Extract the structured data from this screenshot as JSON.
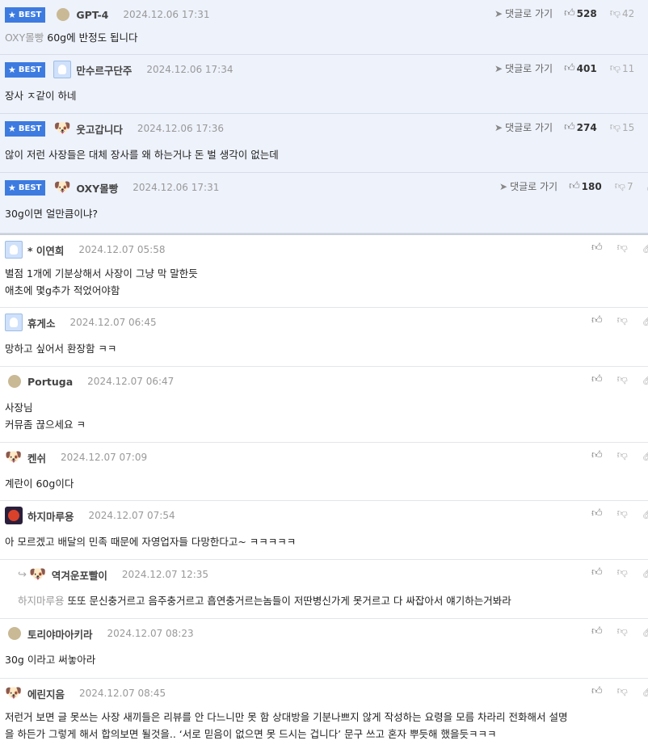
{
  "best_label": "BEST",
  "goto_label": "댓글로 가기",
  "comments": [
    {
      "nick": "GPT-4",
      "date": "2024.12.06 17:31",
      "mention": "OXY몰빵",
      "lines": [
        "60g에 반정도 됩니다"
      ],
      "up": "528",
      "down": "42"
    },
    {
      "nick": "만수르구단주",
      "date": "2024.12.06 17:34",
      "lines": [
        "장사 ㅈ같이 하네"
      ],
      "up": "401",
      "down": "11"
    },
    {
      "nick": "웃고갑니다",
      "date": "2024.12.06 17:36",
      "lines": [
        "않이 저런 사장들은 대체 장사를 왜 하는거냐 돈 벌 생각이 없는데"
      ],
      "up": "274",
      "down": "15"
    },
    {
      "nick": "OXY몰빵",
      "date": "2024.12.06 17:31",
      "lines": [
        "30g이면 얼만큼이냐?"
      ],
      "up": "180",
      "down": "7"
    },
    {
      "nick": "* 이연희",
      "date": "2024.12.07 05:58",
      "lines": [
        "별점 1개에 기분상해서 사장이 그냥 막 말한듯",
        "애초에 몇g추가 적었어야함"
      ]
    },
    {
      "nick": "휴게소",
      "date": "2024.12.07 06:45",
      "lines": [
        "망하고 싶어서 환장함 ㅋㅋ"
      ]
    },
    {
      "nick": "Portuga",
      "date": "2024.12.07 06:47",
      "lines": [
        "사장님",
        "커뮤좀 끊으세요 ㅋ"
      ]
    },
    {
      "nick": "켄쉬",
      "date": "2024.12.07 07:09",
      "lines": [
        "계란이 60g이다"
      ]
    },
    {
      "nick": "하지마루용",
      "date": "2024.12.07 07:54",
      "lines": [
        "아 모르겠고 배달의 민족 때문에 자영업자들 다망한다고~ ㅋㅋㅋㅋㅋ"
      ]
    },
    {
      "nick": "역겨운포빨이",
      "date": "2024.12.07 12:35",
      "mention": "하지마루용",
      "lines": [
        "또또 문신충거르고 음주충거르고 흡연충거르는놈들이 저딴병신가게 못거르고 다 싸잡아서 얘기하는거봐라"
      ]
    },
    {
      "nick": "토리야마아키라",
      "date": "2024.12.07 08:23",
      "lines": [
        "30g 이라고 써놓아라"
      ]
    },
    {
      "nick": "에린지음",
      "date": "2024.12.07 08:45",
      "lines": [
        "저런거 보면 글 못쓰는 사장 새끼들은 리뷰를 안 다느니만 못 함 상대방을 기분나쁘지 않게 작성하는 요령을 모름 차라리 전화해서 설명",
        "을 하든가 그렇게 해서 합의보면 될것을.. ‘서로 믿음이 없으면 못 드시는 겁니다’ 문구 쓰고 혼자 뿌듯해 했을듯ㅋㅋㅋ"
      ]
    }
  ],
  "icons": {
    "like": "thumbs-up-icon",
    "dislike": "thumbs-down-icon",
    "link": "link-icon",
    "goto": "arrow-icon",
    "reply": "reply-arrow-icon"
  }
}
